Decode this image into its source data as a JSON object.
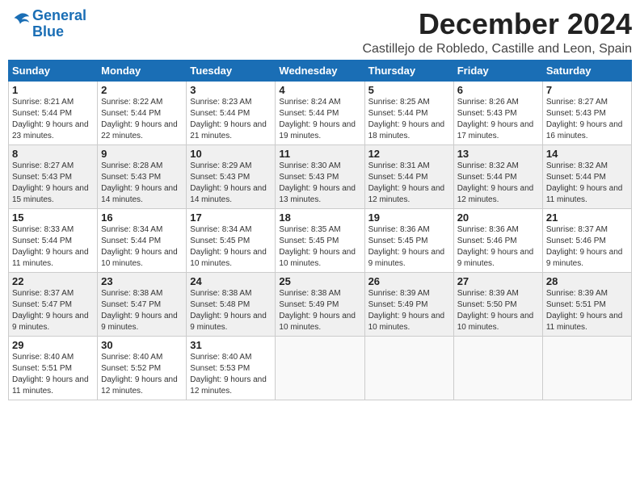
{
  "logo": {
    "line1": "General",
    "line2": "Blue"
  },
  "title": "December 2024",
  "location": "Castillejo de Robledo, Castille and Leon, Spain",
  "headers": [
    "Sunday",
    "Monday",
    "Tuesday",
    "Wednesday",
    "Thursday",
    "Friday",
    "Saturday"
  ],
  "weeks": [
    [
      {
        "day": "1",
        "sunrise": "8:21 AM",
        "sunset": "5:44 PM",
        "daylight": "9 hours and 23 minutes."
      },
      {
        "day": "2",
        "sunrise": "8:22 AM",
        "sunset": "5:44 PM",
        "daylight": "9 hours and 22 minutes."
      },
      {
        "day": "3",
        "sunrise": "8:23 AM",
        "sunset": "5:44 PM",
        "daylight": "9 hours and 21 minutes."
      },
      {
        "day": "4",
        "sunrise": "8:24 AM",
        "sunset": "5:44 PM",
        "daylight": "9 hours and 19 minutes."
      },
      {
        "day": "5",
        "sunrise": "8:25 AM",
        "sunset": "5:44 PM",
        "daylight": "9 hours and 18 minutes."
      },
      {
        "day": "6",
        "sunrise": "8:26 AM",
        "sunset": "5:43 PM",
        "daylight": "9 hours and 17 minutes."
      },
      {
        "day": "7",
        "sunrise": "8:27 AM",
        "sunset": "5:43 PM",
        "daylight": "9 hours and 16 minutes."
      }
    ],
    [
      {
        "day": "8",
        "sunrise": "8:27 AM",
        "sunset": "5:43 PM",
        "daylight": "9 hours and 15 minutes."
      },
      {
        "day": "9",
        "sunrise": "8:28 AM",
        "sunset": "5:43 PM",
        "daylight": "9 hours and 14 minutes."
      },
      {
        "day": "10",
        "sunrise": "8:29 AM",
        "sunset": "5:43 PM",
        "daylight": "9 hours and 14 minutes."
      },
      {
        "day": "11",
        "sunrise": "8:30 AM",
        "sunset": "5:43 PM",
        "daylight": "9 hours and 13 minutes."
      },
      {
        "day": "12",
        "sunrise": "8:31 AM",
        "sunset": "5:44 PM",
        "daylight": "9 hours and 12 minutes."
      },
      {
        "day": "13",
        "sunrise": "8:32 AM",
        "sunset": "5:44 PM",
        "daylight": "9 hours and 12 minutes."
      },
      {
        "day": "14",
        "sunrise": "8:32 AM",
        "sunset": "5:44 PM",
        "daylight": "9 hours and 11 minutes."
      }
    ],
    [
      {
        "day": "15",
        "sunrise": "8:33 AM",
        "sunset": "5:44 PM",
        "daylight": "9 hours and 11 minutes."
      },
      {
        "day": "16",
        "sunrise": "8:34 AM",
        "sunset": "5:44 PM",
        "daylight": "9 hours and 10 minutes."
      },
      {
        "day": "17",
        "sunrise": "8:34 AM",
        "sunset": "5:45 PM",
        "daylight": "9 hours and 10 minutes."
      },
      {
        "day": "18",
        "sunrise": "8:35 AM",
        "sunset": "5:45 PM",
        "daylight": "9 hours and 10 minutes."
      },
      {
        "day": "19",
        "sunrise": "8:36 AM",
        "sunset": "5:45 PM",
        "daylight": "9 hours and 9 minutes."
      },
      {
        "day": "20",
        "sunrise": "8:36 AM",
        "sunset": "5:46 PM",
        "daylight": "9 hours and 9 minutes."
      },
      {
        "day": "21",
        "sunrise": "8:37 AM",
        "sunset": "5:46 PM",
        "daylight": "9 hours and 9 minutes."
      }
    ],
    [
      {
        "day": "22",
        "sunrise": "8:37 AM",
        "sunset": "5:47 PM",
        "daylight": "9 hours and 9 minutes."
      },
      {
        "day": "23",
        "sunrise": "8:38 AM",
        "sunset": "5:47 PM",
        "daylight": "9 hours and 9 minutes."
      },
      {
        "day": "24",
        "sunrise": "8:38 AM",
        "sunset": "5:48 PM",
        "daylight": "9 hours and 9 minutes."
      },
      {
        "day": "25",
        "sunrise": "8:38 AM",
        "sunset": "5:49 PM",
        "daylight": "9 hours and 10 minutes."
      },
      {
        "day": "26",
        "sunrise": "8:39 AM",
        "sunset": "5:49 PM",
        "daylight": "9 hours and 10 minutes."
      },
      {
        "day": "27",
        "sunrise": "8:39 AM",
        "sunset": "5:50 PM",
        "daylight": "9 hours and 10 minutes."
      },
      {
        "day": "28",
        "sunrise": "8:39 AM",
        "sunset": "5:51 PM",
        "daylight": "9 hours and 11 minutes."
      }
    ],
    [
      {
        "day": "29",
        "sunrise": "8:40 AM",
        "sunset": "5:51 PM",
        "daylight": "9 hours and 11 minutes."
      },
      {
        "day": "30",
        "sunrise": "8:40 AM",
        "sunset": "5:52 PM",
        "daylight": "9 hours and 12 minutes."
      },
      {
        "day": "31",
        "sunrise": "8:40 AM",
        "sunset": "5:53 PM",
        "daylight": "9 hours and 12 minutes."
      },
      null,
      null,
      null,
      null
    ]
  ]
}
